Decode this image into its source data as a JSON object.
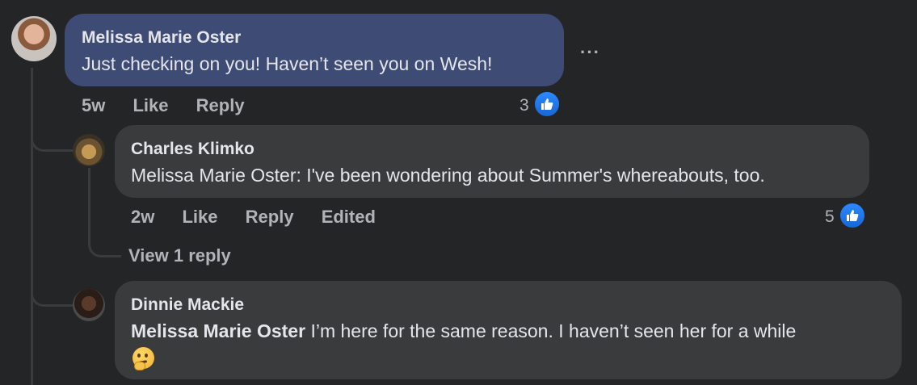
{
  "comments": [
    {
      "author": "Melissa Marie Oster",
      "text": "Just checking on you! Haven’t seen you on Wesh!",
      "time": "5w",
      "like_label": "Like",
      "reply_label": "Reply",
      "reaction_count": "3",
      "more_label": "···"
    },
    {
      "author": "Charles Klimko",
      "text": "Melissa Marie Oster: I've been wondering about Summer's whereabouts, too.",
      "time": "2w",
      "like_label": "Like",
      "reply_label": "Reply",
      "edited_label": "Edited",
      "reaction_count": "5",
      "view_replies_label": "View 1 reply"
    },
    {
      "author": "Dinnie Mackie",
      "mention": "Melissa Marie Oster",
      "text": " I’m here for the same reason. I haven’t seen her for a while"
    }
  ],
  "icons": {
    "reaction": "thumbs-up-icon",
    "emoji": "thinking-face-emoji"
  },
  "colors": {
    "background": "#242526",
    "bubble": "#3a3b3c",
    "highlighted_bubble": "#3e4b74",
    "like_blue": "#2d88ff"
  }
}
